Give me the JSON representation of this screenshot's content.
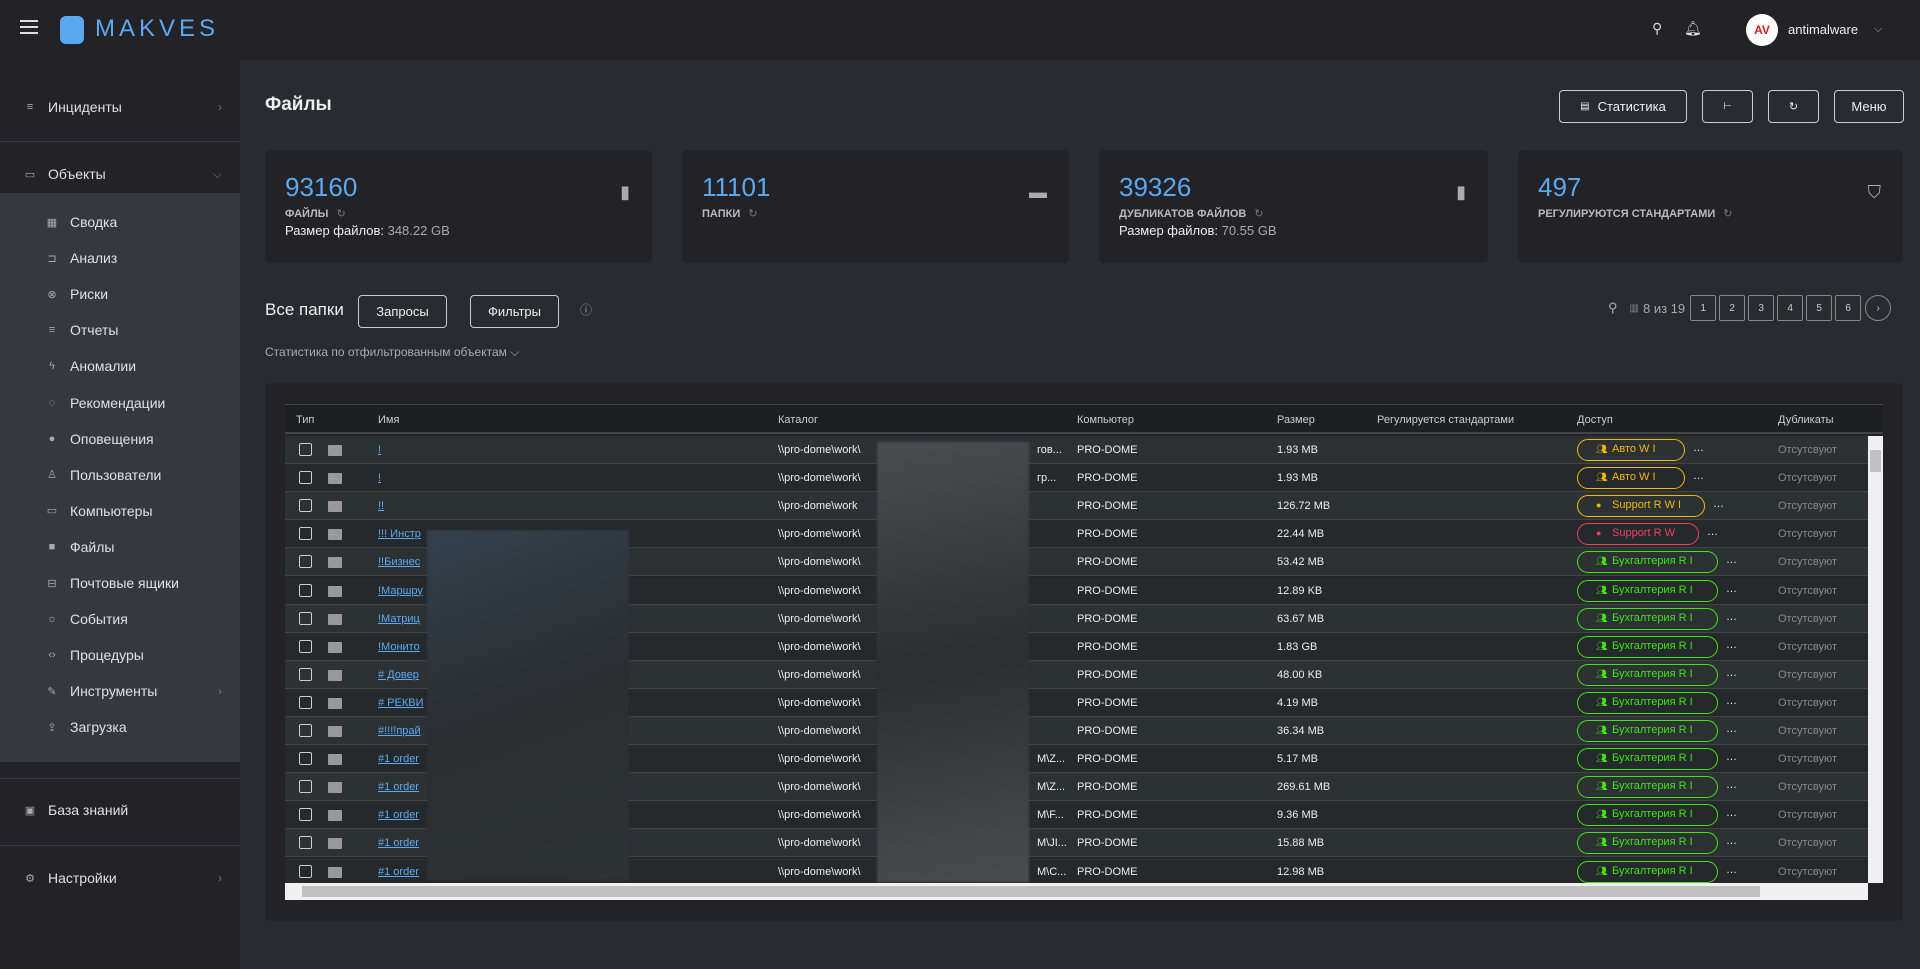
{
  "header": {
    "brand": "MAKVES",
    "user": "antimalware",
    "avatar_text": "AV"
  },
  "sidebar": {
    "incidents": "Инциденты",
    "objects": "Объекты",
    "items": [
      {
        "label": "Сводка",
        "icon": "grid-icon",
        "g": "▦"
      },
      {
        "label": "Анализ",
        "icon": "analysis-icon",
        "g": "⊐"
      },
      {
        "label": "Риски",
        "icon": "risk-icon",
        "g": "⊗"
      },
      {
        "label": "Отчеты",
        "icon": "reports-icon",
        "g": "≡"
      },
      {
        "label": "Аномалии",
        "icon": "anomaly-icon",
        "g": "ϟ"
      },
      {
        "label": "Рекомендации",
        "icon": "bulb-icon",
        "g": "◌"
      },
      {
        "label": "Оповещения",
        "icon": "alert-icon",
        "g": "●"
      },
      {
        "label": "Пользователи",
        "icon": "user-icon",
        "g": "♙"
      },
      {
        "label": "Компьютеры",
        "icon": "computer-icon",
        "g": "▭"
      },
      {
        "label": "Файлы",
        "icon": "file-icon",
        "g": "■"
      },
      {
        "label": "Почтовые ящики",
        "icon": "mailbox-icon",
        "g": "⊟"
      },
      {
        "label": "События",
        "icon": "siren-icon",
        "g": "☼"
      },
      {
        "label": "Процедуры",
        "icon": "code-icon",
        "g": "‹›"
      },
      {
        "label": "Инструменты",
        "icon": "wrench-icon",
        "g": "✎",
        "chev": true
      },
      {
        "label": "Загрузка",
        "icon": "upload-icon",
        "g": "⇪"
      }
    ],
    "knowledge": "База знаний",
    "settings": "Настройки"
  },
  "page": {
    "title": "Файлы",
    "btn_stats": "Статистика",
    "btn_menu": "Меню"
  },
  "cards": [
    {
      "num": "93160",
      "label": "ФАЙЛЫ",
      "size_label": "Размер файлов:",
      "size": "348.22 GB",
      "icon": "file-icon"
    },
    {
      "num": "11101",
      "label": "ПАПКИ",
      "icon": "folder-icon"
    },
    {
      "num": "39326",
      "label": "ДУБЛИКАТОВ ФАЙЛОВ",
      "size_label": "Размер файлов:",
      "size": "70.55 GB",
      "icon": "file-copy-icon"
    },
    {
      "num": "497",
      "label": "РЕГУЛИРУЮТСЯ СТАНДАРТАМИ",
      "icon": "shield-check-icon"
    }
  ],
  "list": {
    "title": "Все папки",
    "btn_queries": "Запросы",
    "btn_filters": "Фильтры",
    "stats_link": "Статистика по отфильтрованным объектам",
    "page_info": "8 из 19",
    "pages": [
      "1",
      "2",
      "3",
      "4",
      "5",
      "6"
    ]
  },
  "table": {
    "columns": [
      "Тип",
      "Имя",
      "Каталог",
      "Компьютер",
      "Размер",
      "Регулируется стандартами",
      "Доступ",
      "Дубликаты"
    ],
    "colors": {
      "yellow": "#f5b800",
      "red": "#f0405a",
      "green": "#3ee60f"
    },
    "rows": [
      {
        "name": "!",
        "cat": "\\\\pro-dome\\work\\",
        "tail": "гов...",
        "pc": "PRO-DOME",
        "size": "1.93 MB",
        "access": "Авто  W I",
        "color": "yellow",
        "group": true,
        "dup": "Отсутсвуют"
      },
      {
        "name": "!",
        "cat": "\\\\pro-dome\\work\\",
        "tail": "гр...",
        "pc": "PRO-DOME",
        "size": "1.93 MB",
        "access": "Авто  W I",
        "color": "yellow",
        "group": true,
        "dup": "Отсутсвуют"
      },
      {
        "name": "!!",
        "cat": "\\\\pro-dome\\work",
        "tail": "",
        "pc": "PRO-DOME",
        "size": "126.72 MB",
        "access": "Support R W I",
        "color": "yellow",
        "group": false,
        "dup": "Отсутсвуют"
      },
      {
        "name": "!!! Инстр",
        "cat": "\\\\pro-dome\\work\\",
        "tail": "",
        "pc": "PRO-DOME",
        "size": "22.44 MB",
        "access": "Support R W",
        "color": "red",
        "group": false,
        "dup": "Отсутсвуют"
      },
      {
        "name": "!!Бизнес",
        "cat": "\\\\pro-dome\\work\\",
        "tail": "",
        "pc": "PRO-DOME",
        "size": "53.42 MB",
        "access": "Бухгалтерия R I",
        "color": "green",
        "group": true,
        "dup": "Отсутсвуют"
      },
      {
        "name": "!Маршру",
        "cat": "\\\\pro-dome\\work\\",
        "tail": "",
        "pc": "PRO-DOME",
        "size": "12.89 KB",
        "access": "Бухгалтерия R I",
        "color": "green",
        "group": true,
        "dup": "Отсутсвуют"
      },
      {
        "name": "!Матриц",
        "cat": "\\\\pro-dome\\work\\",
        "tail": "",
        "pc": "PRO-DOME",
        "size": "63.67 MB",
        "access": "Бухгалтерия R I",
        "color": "green",
        "group": true,
        "dup": "Отсутсвуют"
      },
      {
        "name": "!Монито",
        "cat": "\\\\pro-dome\\work\\",
        "tail": "",
        "pc": "PRO-DOME",
        "size": "1.83 GB",
        "access": "Бухгалтерия R I",
        "color": "green",
        "group": true,
        "dup": "Отсутсвуют"
      },
      {
        "name": "# Довер",
        "cat": "\\\\pro-dome\\work\\",
        "tail": "",
        "pc": "PRO-DOME",
        "size": "48.00 KB",
        "access": "Бухгалтерия R I",
        "color": "green",
        "group": true,
        "dup": "Отсутсвуют"
      },
      {
        "name": "# РЕКВИ",
        "cat": "\\\\pro-dome\\work\\",
        "tail": "",
        "pc": "PRO-DOME",
        "size": "4.19 MB",
        "access": "Бухгалтерия R I",
        "color": "green",
        "group": true,
        "dup": "Отсутсвуют"
      },
      {
        "name": "#!!!!прай",
        "cat": "\\\\pro-dome\\work\\",
        "tail": "",
        "pc": "PRO-DOME",
        "size": "36.34 MB",
        "access": "Бухгалтерия R I",
        "color": "green",
        "group": true,
        "dup": "Отсутсвуют"
      },
      {
        "name": "#1 order",
        "cat": "\\\\pro-dome\\work\\",
        "tail": "М\\Z...",
        "pc": "PRO-DOME",
        "size": "5.17 MB",
        "access": "Бухгалтерия R I",
        "color": "green",
        "group": true,
        "dup": "Отсутсвуют"
      },
      {
        "name": "#1 order",
        "cat": "\\\\pro-dome\\work\\",
        "tail": "М\\Z...",
        "pc": "PRO-DOME",
        "size": "269.61 MB",
        "access": "Бухгалтерия R I",
        "color": "green",
        "group": true,
        "dup": "Отсутсвуют"
      },
      {
        "name": "#1 order",
        "cat": "\\\\pro-dome\\work\\",
        "tail": "М\\F...",
        "pc": "PRO-DOME",
        "size": "9.36 MB",
        "access": "Бухгалтерия R I",
        "color": "green",
        "group": true,
        "dup": "Отсутсвуют"
      },
      {
        "name": "#1 order",
        "cat": "\\\\pro-dome\\work\\",
        "tail": "М\\JI...",
        "pc": "PRO-DOME",
        "size": "15.88 MB",
        "access": "Бухгалтерия R I",
        "color": "green",
        "group": true,
        "dup": "Отсутсвуют"
      },
      {
        "name": "#1 order",
        "cat": "\\\\pro-dome\\work\\",
        "tail": "М\\C...",
        "pc": "PRO-DOME",
        "size": "12.98 MB",
        "access": "Бухгалтерия R I",
        "color": "green",
        "group": true,
        "dup": "Отсутсвуют"
      }
    ]
  }
}
